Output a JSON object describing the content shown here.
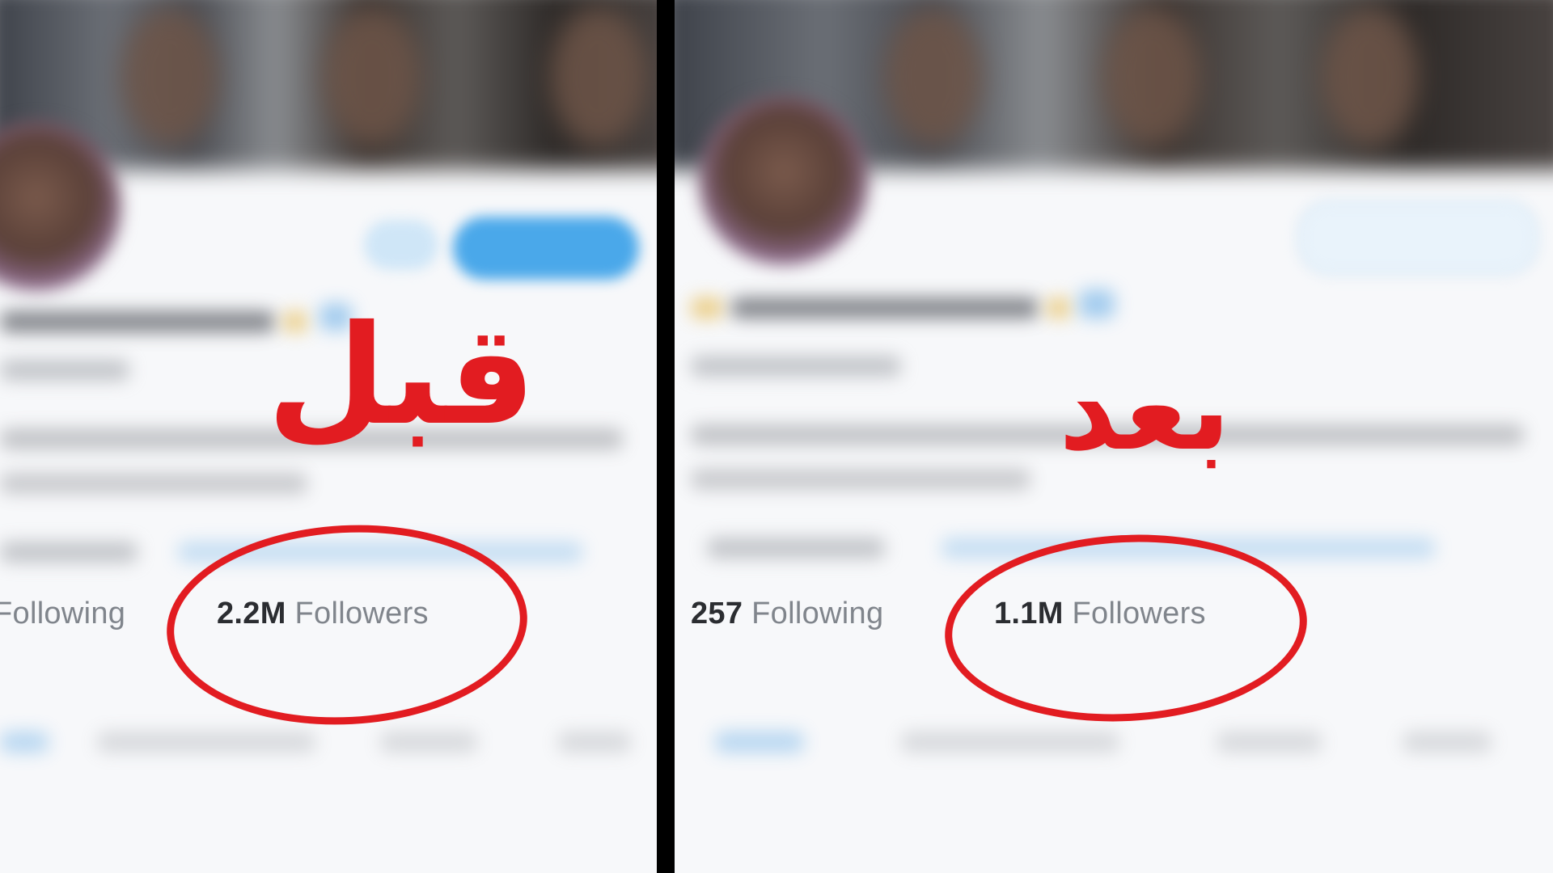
{
  "panels": {
    "before": {
      "caption": "قبل",
      "following_label": "Following",
      "followers_count": "2.2M",
      "followers_label": "Followers"
    },
    "after": {
      "caption": "بعد",
      "following_count": "257",
      "following_label": "Following",
      "followers_count": "1.1M",
      "followers_label": "Followers"
    }
  },
  "colors": {
    "annotation_red": "#e21c21",
    "divider": "#000000",
    "follow_button_blue": "#4aa8ea",
    "stat_number": "#2b2d31",
    "stat_label": "#80858c"
  }
}
